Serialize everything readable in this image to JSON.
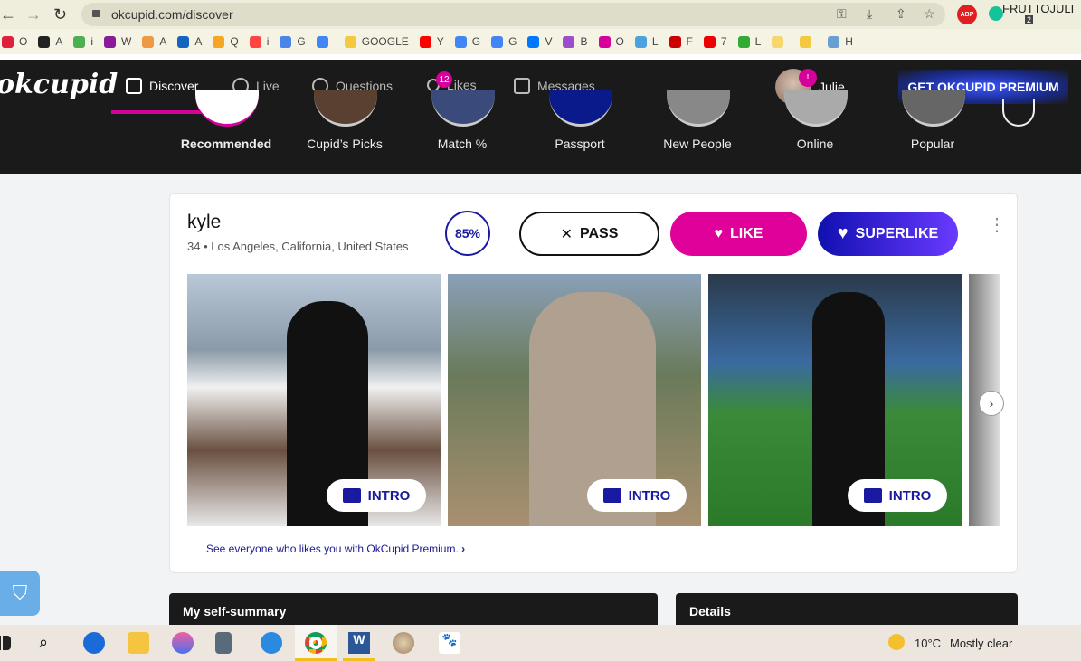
{
  "browser": {
    "url": "okcupid.com/discover",
    "profile": "FRUTTOJULI",
    "ext_badge": "2",
    "abp": "ABP",
    "bookmarks": [
      {
        "label": "O",
        "color": "#e0203a"
      },
      {
        "label": "A",
        "color": "#222"
      },
      {
        "label": "i",
        "color": "#4caf50"
      },
      {
        "label": "W",
        "color": "#8a1a9a"
      },
      {
        "label": "A",
        "color": "#e94"
      },
      {
        "label": "A",
        "color": "#1565c0"
      },
      {
        "label": "Q",
        "color": "#f5a623"
      },
      {
        "label": "i",
        "color": "#f44"
      },
      {
        "label": "G",
        "color": "#4a86e8"
      },
      {
        "label": "",
        "color": "#4285f4"
      },
      {
        "label": "GOOGLE",
        "color": "#f5c842"
      },
      {
        "label": "Y",
        "color": "#f00"
      },
      {
        "label": "G",
        "color": "#4285f4"
      },
      {
        "label": "G",
        "color": "#4285f4"
      },
      {
        "label": "V",
        "color": "#0077ff"
      },
      {
        "label": "B",
        "color": "#9c4dcc"
      },
      {
        "label": "O",
        "color": "#d6009a"
      },
      {
        "label": "L",
        "color": "#4aa3df"
      },
      {
        "label": "F",
        "color": "#c00"
      },
      {
        "label": "7",
        "color": "#e00"
      },
      {
        "label": "L",
        "color": "#3a3"
      },
      {
        "label": "",
        "color": "#f5d76e"
      },
      {
        "label": "",
        "color": "#f5c842"
      },
      {
        "label": "H",
        "color": "#6a9fd4"
      }
    ]
  },
  "nav": {
    "logo": "okcupid",
    "items": [
      {
        "label": "Discover",
        "icon": "discover-icon"
      },
      {
        "label": "Live",
        "icon": "live-icon"
      },
      {
        "label": "Questions",
        "icon": "questions-icon"
      },
      {
        "label": "Likes",
        "icon": "likes-icon",
        "badge": "12"
      },
      {
        "label": "Messages",
        "icon": "messages-icon"
      }
    ],
    "user": "Julie",
    "user_badge": "!",
    "premium": "GET OKCUPID PREMIUM",
    "categories": [
      "Recommended",
      "Cupid’s Picks",
      "Match %",
      "Passport",
      "New People",
      "Online",
      "Popular"
    ]
  },
  "profile": {
    "name": "kyle",
    "meta": "34 • Los Angeles, California, United States",
    "match": "85%",
    "pass": "PASS",
    "like": "LIKE",
    "superlike": "SUPERLIKE",
    "intro": "INTRO",
    "premium_link": "See everyone who likes you with OkCupid Premium.",
    "photos": 3
  },
  "panels": {
    "summary": "My self-summary",
    "details": "Details"
  },
  "taskbar": {
    "temp": "10°C",
    "weather": "Mostly clear"
  },
  "colors": {
    "accent": "#d6009a",
    "superlike": "#1a1aa0",
    "nav_bg": "#1a1a1a"
  }
}
